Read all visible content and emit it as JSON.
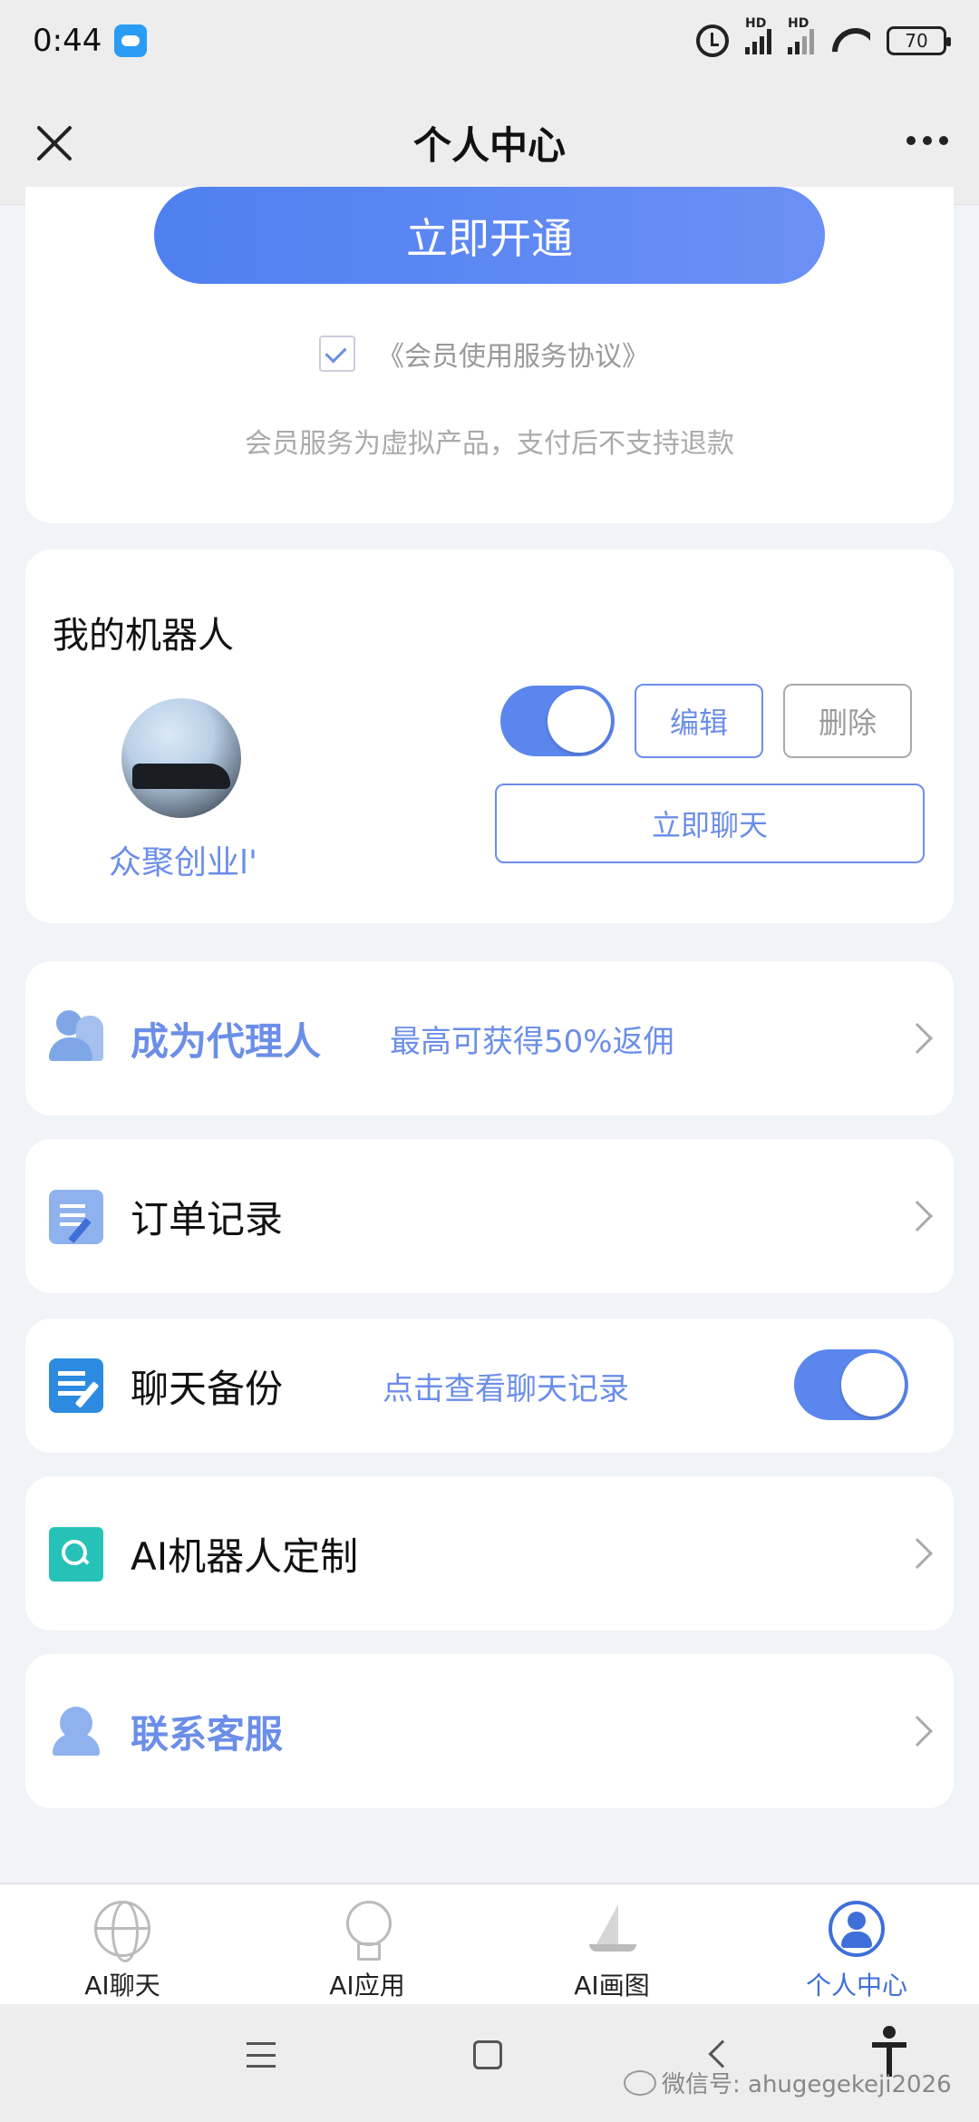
{
  "status_bar": {
    "time": "0:44",
    "battery": "70"
  },
  "nav": {
    "title": "个人中心"
  },
  "membership": {
    "open_button": "立即开通",
    "agreement": "《会员使用服务协议》",
    "notice": "会员服务为虚拟产品，支付后不支持退款"
  },
  "robot": {
    "section_title": "我的机器人",
    "name": "众聚创业l'",
    "enabled": true,
    "edit_label": "编辑",
    "delete_label": "删除",
    "chat_label": "立即聊天"
  },
  "menu": {
    "agent": {
      "label": "成为代理人",
      "sub": "最高可获得50%返佣"
    },
    "orders": {
      "label": "订单记录"
    },
    "backup": {
      "label": "聊天备份",
      "sub": "点击查看聊天记录",
      "enabled": true
    },
    "custom": {
      "label": "AI机器人定制"
    },
    "service": {
      "label": "联系客服"
    }
  },
  "tabs": [
    {
      "label": "AI聊天",
      "icon": "globe-icon",
      "active": false
    },
    {
      "label": "AI应用",
      "icon": "bulb-icon",
      "active": false
    },
    {
      "label": "AI画图",
      "icon": "sail-icon",
      "active": false
    },
    {
      "label": "个人中心",
      "icon": "user-icon",
      "active": true
    }
  ],
  "watermark": "微信号: ahugegekeji2026",
  "colors": {
    "accent": "#5b86ee",
    "accent_text": "#6b8ee8",
    "active_tab": "#3f6fd8",
    "background": "#f0f3f7"
  }
}
